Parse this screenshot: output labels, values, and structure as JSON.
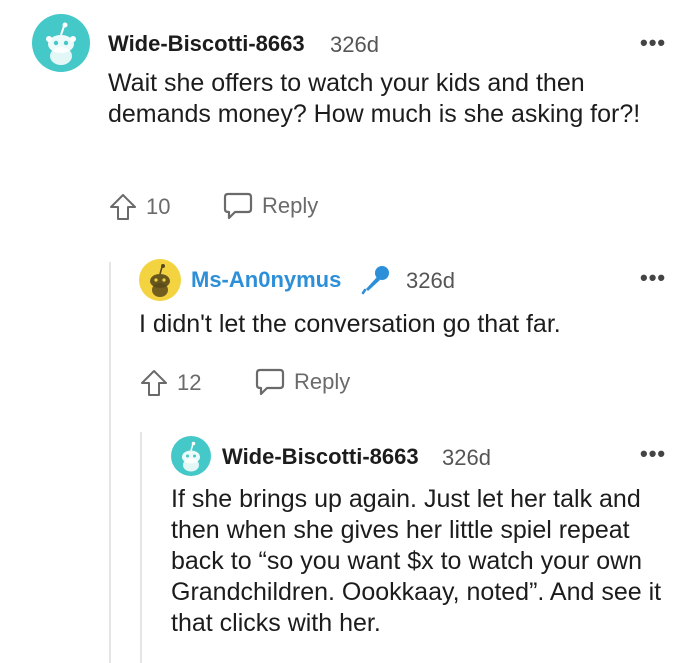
{
  "comments": [
    {
      "username": "Wide-Biscotti-8663",
      "age": "326d",
      "more_label": "•••",
      "body": "Wait she offers to watch your kids and then demands money? How much is she asking for?!",
      "votes": "10",
      "reply_label": "Reply",
      "avatar_color": "#45c8c8"
    },
    {
      "username": "Ms-An0nymus",
      "age": "326d",
      "more_label": "•••",
      "body": "I didn't let the conversation go that far.",
      "votes": "12",
      "reply_label": "Reply",
      "avatar_color": "#f3d33f",
      "flair_icon": "microphone-icon"
    },
    {
      "username": "Wide-Biscotti-8663",
      "age": "326d",
      "more_label": "•••",
      "body": "If she brings up again. Just let her talk and then when she gives her little spiel repeat back to “so you want $x to watch your own Grandchildren. Oookkaay, noted”. And see it that clicks with her.",
      "avatar_color": "#45c8c8"
    }
  ],
  "colors": {
    "op_username": "#2d8fd8",
    "thread_line": "#e5e5e5",
    "meta_text": "#6a6a6a"
  }
}
